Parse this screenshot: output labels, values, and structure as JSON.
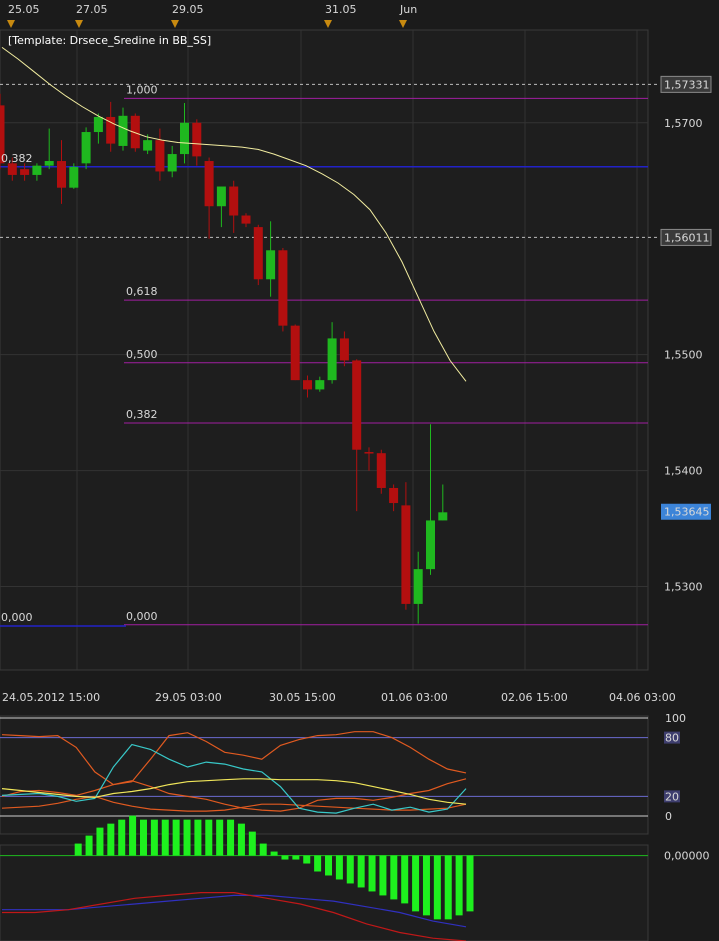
{
  "template_label": "[Template: Drsece_Sredine in BB_SS]",
  "colors": {
    "background": "#1b1b1b",
    "panel_bg": "#1e1e1e",
    "grid": "#333333",
    "bull": "#1fb81f",
    "bear": "#b30f0f",
    "fib_line": "#a01fa0",
    "blue_line": "#2222c8",
    "moving_average": "#f2eda0",
    "price_tag": "#3c84d8",
    "stoch_orange": "#e05a20",
    "stoch_cyan": "#38c8c8",
    "stoch_yellow": "#f0e65a",
    "hist_green": "#1ef01e",
    "osc_blue": "#3030c0",
    "osc_red": "#c01818"
  },
  "event_markers": [
    "25.05",
    "27.05",
    "29.05",
    "31.05",
    "Jun"
  ],
  "chart_data": [
    {
      "type": "candlestick",
      "x_tick_labels": [
        "24.05.2012 15:00",
        "29.05 03:00",
        "30.05 15:00",
        "01.06 03:00",
        "02.06 15:00",
        "04.06 03:00"
      ],
      "y_tick_labels": [
        "1,5700",
        "1,5500",
        "1,5400",
        "1,5300"
      ],
      "ylim": [
        1.5228,
        1.578
      ],
      "dashed_levels": [
        {
          "value": 1.57331,
          "label": "1,57331"
        },
        {
          "value": 1.56011,
          "label": "1,56011"
        }
      ],
      "last_price": {
        "value": 1.53645,
        "label": "1,53645"
      },
      "fib_levels": [
        {
          "label": "1,000",
          "value": 1.5721
        },
        {
          "label": "0,618",
          "value": 1.5547
        },
        {
          "label": "0,500",
          "value": 1.5493
        },
        {
          "label": "0,382",
          "value": 1.5441
        },
        {
          "label": "0,000",
          "value": 1.5267
        }
      ],
      "blue_levels": [
        {
          "label": "0,382",
          "value": 1.5662
        },
        {
          "label": "0,000",
          "value": 1.5266
        }
      ],
      "candles": [
        {
          "o": 1.5715,
          "h": 1.5725,
          "l": 1.566,
          "c": 1.5665
        },
        {
          "o": 1.5665,
          "h": 1.567,
          "l": 1.565,
          "c": 1.5655
        },
        {
          "o": 1.566,
          "h": 1.5665,
          "l": 1.565,
          "c": 1.5655
        },
        {
          "o": 1.5655,
          "h": 1.5665,
          "l": 1.565,
          "c": 1.5663
        },
        {
          "o": 1.5663,
          "h": 1.5695,
          "l": 1.566,
          "c": 1.5667
        },
        {
          "o": 1.5667,
          "h": 1.5685,
          "l": 1.563,
          "c": 1.5644
        },
        {
          "o": 1.5644,
          "h": 1.5665,
          "l": 1.5643,
          "c": 1.5662
        },
        {
          "o": 1.5665,
          "h": 1.5696,
          "l": 1.566,
          "c": 1.5692
        },
        {
          "o": 1.5692,
          "h": 1.5708,
          "l": 1.5682,
          "c": 1.5705
        },
        {
          "o": 1.5705,
          "h": 1.5718,
          "l": 1.5675,
          "c": 1.5682
        },
        {
          "o": 1.568,
          "h": 1.5713,
          "l": 1.5676,
          "c": 1.5706
        },
        {
          "o": 1.5706,
          "h": 1.5708,
          "l": 1.5675,
          "c": 1.5678
        },
        {
          "o": 1.5676,
          "h": 1.569,
          "l": 1.5673,
          "c": 1.5685
        },
        {
          "o": 1.5685,
          "h": 1.5695,
          "l": 1.565,
          "c": 1.5658
        },
        {
          "o": 1.5658,
          "h": 1.568,
          "l": 1.5653,
          "c": 1.5673
        },
        {
          "o": 1.5673,
          "h": 1.5717,
          "l": 1.5665,
          "c": 1.57
        },
        {
          "o": 1.57,
          "h": 1.5703,
          "l": 1.5663,
          "c": 1.5671
        },
        {
          "o": 1.5667,
          "h": 1.567,
          "l": 1.56,
          "c": 1.5628
        },
        {
          "o": 1.5628,
          "h": 1.5645,
          "l": 1.561,
          "c": 1.5645
        },
        {
          "o": 1.5645,
          "h": 1.565,
          "l": 1.5605,
          "c": 1.562
        },
        {
          "o": 1.562,
          "h": 1.5622,
          "l": 1.561,
          "c": 1.5613
        },
        {
          "o": 1.561,
          "h": 1.5612,
          "l": 1.556,
          "c": 1.5565
        },
        {
          "o": 1.5565,
          "h": 1.5615,
          "l": 1.555,
          "c": 1.559
        },
        {
          "o": 1.559,
          "h": 1.5592,
          "l": 1.552,
          "c": 1.5525
        },
        {
          "o": 1.5525,
          "h": 1.5526,
          "l": 1.5478,
          "c": 1.5478
        },
        {
          "o": 1.5478,
          "h": 1.5482,
          "l": 1.5463,
          "c": 1.547
        },
        {
          "o": 1.547,
          "h": 1.5481,
          "l": 1.5468,
          "c": 1.5478
        },
        {
          "o": 1.5478,
          "h": 1.5528,
          "l": 1.5475,
          "c": 1.5514
        },
        {
          "o": 1.5514,
          "h": 1.552,
          "l": 1.549,
          "c": 1.5495
        },
        {
          "o": 1.5495,
          "h": 1.5496,
          "l": 1.5365,
          "c": 1.5418
        },
        {
          "o": 1.5416,
          "h": 1.542,
          "l": 1.54,
          "c": 1.5415
        },
        {
          "o": 1.5415,
          "h": 1.5418,
          "l": 1.538,
          "c": 1.5385
        },
        {
          "o": 1.5385,
          "h": 1.5388,
          "l": 1.5365,
          "c": 1.5372
        },
        {
          "o": 1.537,
          "h": 1.539,
          "l": 1.528,
          "c": 1.5285
        },
        {
          "o": 1.5285,
          "h": 1.533,
          "l": 1.5268,
          "c": 1.5315
        },
        {
          "o": 1.5315,
          "h": 1.544,
          "l": 1.531,
          "c": 1.5357
        },
        {
          "o": 1.5357,
          "h": 1.5388,
          "l": 1.5357,
          "c": 1.5364
        }
      ],
      "moving_average": [
        1.5765,
        1.5755,
        1.5744,
        1.5733,
        1.5723,
        1.5714,
        1.5706,
        1.5699,
        1.5693,
        1.5688,
        1.5685,
        1.5683,
        1.5682,
        1.5681,
        1.568,
        1.5679,
        1.5677,
        1.5673,
        1.5668,
        1.5663,
        1.5656,
        1.5648,
        1.5638,
        1.5625,
        1.5605,
        1.558,
        1.555,
        1.552,
        1.5495,
        1.5477
      ]
    },
    {
      "type": "line",
      "panel": "stochastic",
      "y_tick_labels": [
        "100",
        "80",
        "20",
        "0"
      ],
      "ylim": [
        0,
        100
      ],
      "levels": [
        100,
        80,
        20,
        0
      ],
      "series": [
        {
          "color_key": "stoch_orange",
          "values": [
            83,
            82,
            81,
            82,
            70,
            45,
            32,
            35,
            58,
            82,
            85,
            76,
            65,
            62,
            58,
            72,
            78,
            82,
            83,
            86,
            86,
            80,
            70,
            58,
            48,
            44
          ]
        },
        {
          "color_key": "stoch_orange",
          "values": [
            20,
            25,
            26,
            24,
            21,
            26,
            32,
            36,
            30,
            23,
            20,
            17,
            12,
            8,
            6,
            5,
            8,
            16,
            18,
            18,
            16,
            19,
            23,
            26,
            33,
            38
          ]
        },
        {
          "color_key": "stoch_orange",
          "values": [
            8,
            9,
            10,
            13,
            17,
            20,
            14,
            10,
            7,
            6,
            5,
            5,
            6,
            9,
            12,
            12,
            11,
            10,
            9,
            8,
            7,
            6,
            6,
            7,
            8,
            12
          ]
        },
        {
          "color_key": "stoch_cyan",
          "values": [
            21,
            22,
            23,
            20,
            15,
            18,
            50,
            73,
            68,
            58,
            50,
            55,
            53,
            48,
            45,
            30,
            8,
            4,
            3,
            8,
            12,
            6,
            9,
            4,
            7,
            28
          ]
        },
        {
          "color_key": "stoch_yellow",
          "values": [
            28,
            26,
            24,
            22,
            20,
            19,
            23,
            25,
            28,
            32,
            35,
            36,
            37,
            38,
            38,
            37,
            37,
            37,
            36,
            34,
            30,
            26,
            22,
            17,
            14,
            12
          ]
        }
      ]
    },
    {
      "type": "bar",
      "panel": "oscillator",
      "y_tick_labels": [
        "0,00000"
      ],
      "ylim": [
        -0.003,
        0.0003
      ],
      "histogram": [
        0,
        0,
        0,
        0,
        0,
        0,
        0,
        3e-05,
        5e-05,
        7e-05,
        8e-05,
        9e-05,
        0.0001,
        9e-05,
        9e-05,
        9e-05,
        9e-05,
        9e-05,
        9e-05,
        9e-05,
        9e-05,
        9e-05,
        8e-05,
        6e-05,
        3e-05,
        1e-05,
        -1e-05,
        -1e-05,
        -2e-05,
        -4e-05,
        -5e-05,
        -6e-05,
        -7e-05,
        -8e-05,
        -9e-05,
        -0.0001,
        -0.00011,
        -0.00012,
        -0.00014,
        -0.00015,
        -0.00016,
        -0.00016,
        -0.00015,
        -0.00014
      ],
      "series": [
        {
          "color_key": "osc_blue",
          "values": [
            -0.0019,
            -0.0019,
            -0.0019,
            -0.0018,
            -0.0017,
            -0.0016,
            -0.0015,
            -0.0014,
            -0.0014,
            -0.0015,
            -0.0016,
            -0.0018,
            -0.002,
            -0.0023,
            -0.0025
          ]
        },
        {
          "color_key": "osc_red",
          "values": [
            -0.002,
            -0.002,
            -0.0019,
            -0.0017,
            -0.0015,
            -0.0014,
            -0.0013,
            -0.0013,
            -0.0015,
            -0.0017,
            -0.002,
            -0.0024,
            -0.0027,
            -0.0029,
            -0.003
          ]
        }
      ]
    }
  ]
}
